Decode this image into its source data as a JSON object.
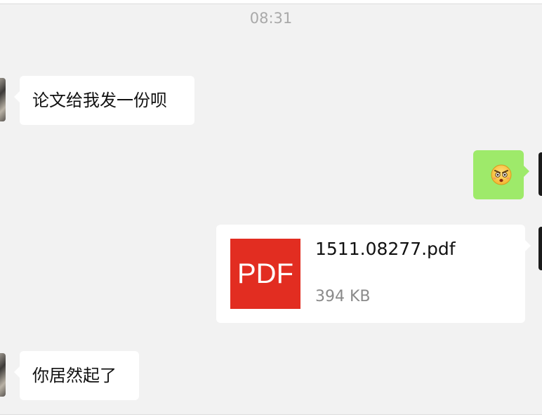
{
  "chat": {
    "timestamp": "08:31",
    "messages": [
      {
        "direction": "incoming",
        "type": "text",
        "text": "论文给我发一份呗"
      },
      {
        "direction": "outgoing",
        "type": "emoji",
        "emoji": "angry-surprised-face"
      },
      {
        "direction": "outgoing",
        "type": "file",
        "file_icon_label": "PDF",
        "file_name": "1511.08277.pdf",
        "file_size": "394 KB"
      },
      {
        "direction": "incoming",
        "type": "text",
        "text": "你居然起了"
      }
    ]
  },
  "colors": {
    "background": "#f2f2f2",
    "incoming_bubble": "#ffffff",
    "outgoing_bubble": "#9eea6a",
    "pdf_icon": "#e22d21",
    "timestamp_text": "#a9a9a9"
  }
}
